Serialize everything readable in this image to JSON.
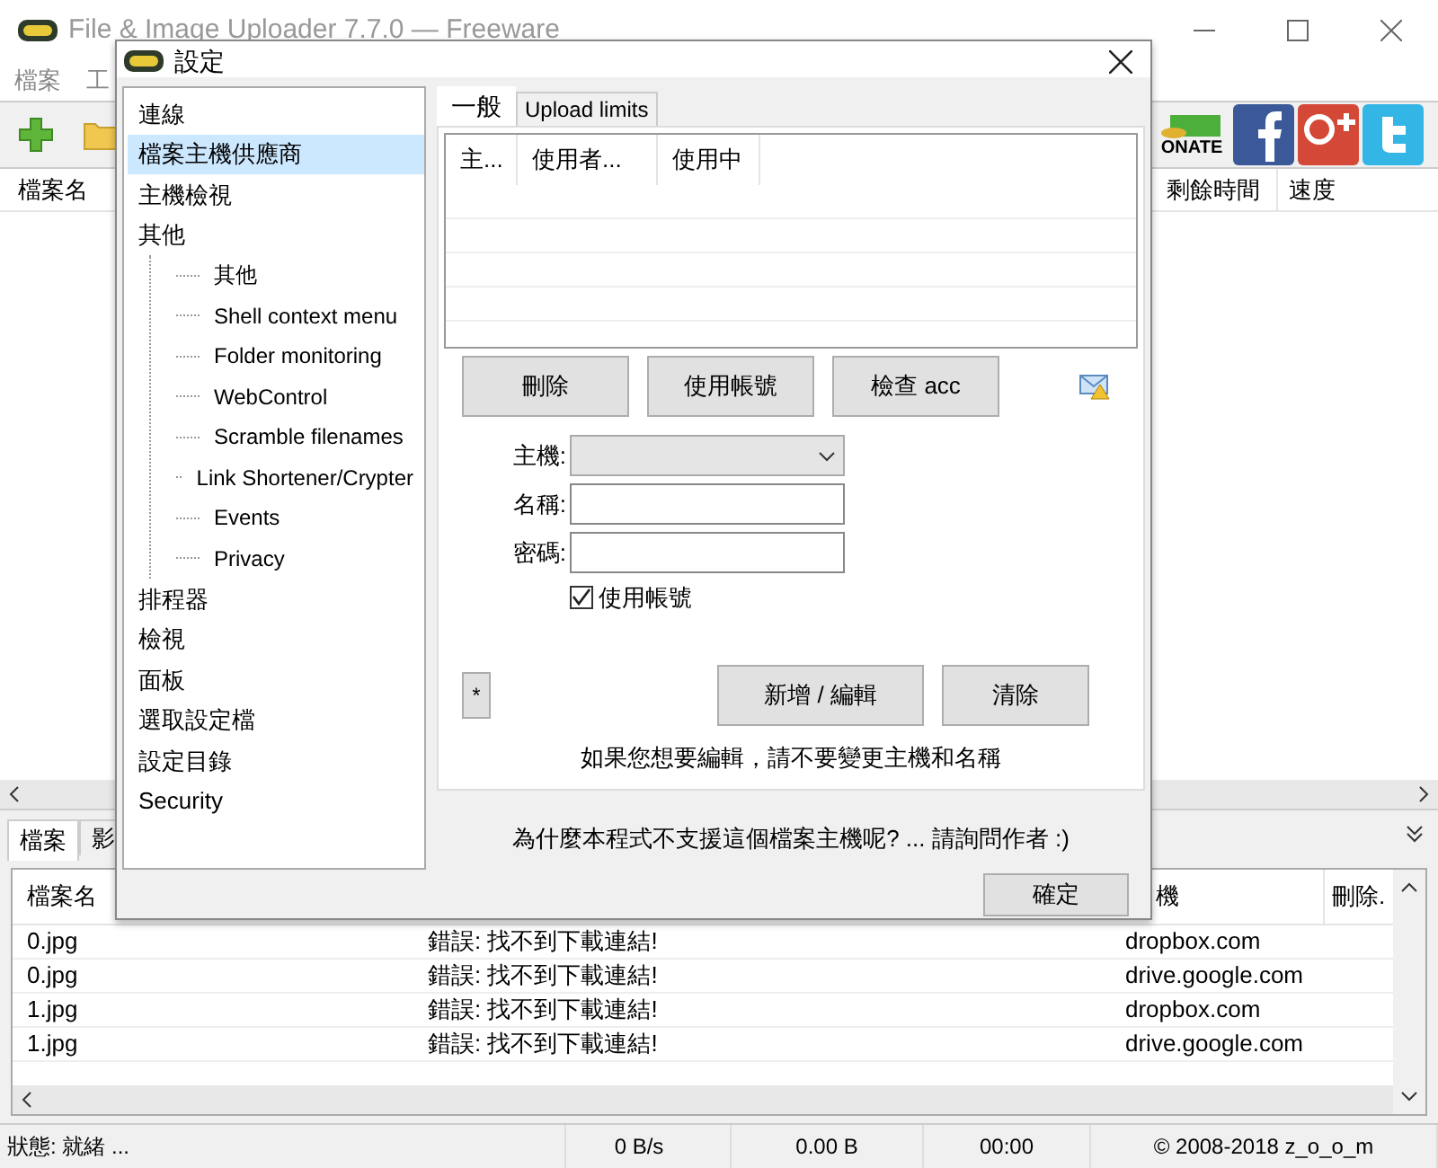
{
  "window": {
    "title": "File & Image Uploader 7.7.0 — Freeware"
  },
  "menu": [
    "檔案",
    "工"
  ],
  "toolbar": {
    "donate_label": "ONATE"
  },
  "upper_list": {
    "columns": [
      "檔案名",
      "剩餘時間",
      "速度"
    ]
  },
  "bottom_tabs": [
    {
      "label": "檔案",
      "selected": true
    },
    {
      "label": "影",
      "selected": false
    }
  ],
  "lower_list": {
    "columns": [
      "檔案名",
      "機",
      "刪除."
    ],
    "rows": [
      {
        "file": "0.jpg",
        "status": "錯誤: 找不到下載連結!",
        "host": "dropbox.com"
      },
      {
        "file": "0.jpg",
        "status": "錯誤: 找不到下載連結!",
        "host": "drive.google.com"
      },
      {
        "file": "1.jpg",
        "status": "錯誤: 找不到下載連結!",
        "host": "dropbox.com"
      },
      {
        "file": "1.jpg",
        "status": "錯誤: 找不到下載連結!",
        "host": "drive.google.com"
      }
    ]
  },
  "status_bar": [
    "狀態: 就緒 ...",
    "0 B/s",
    "0.00 B",
    "00:00",
    "© 2008-2018 z_o_o_m"
  ],
  "dialog": {
    "title": "設定",
    "tree": [
      {
        "label": "連線",
        "selected": false
      },
      {
        "label": "檔案主機供應商",
        "selected": true
      },
      {
        "label": "主機檢視",
        "selected": false
      },
      {
        "label": "其他",
        "selected": false,
        "children": [
          {
            "label": "其他",
            "selected": false
          },
          {
            "label": "Shell context menu",
            "selected": false
          },
          {
            "label": "Folder monitoring",
            "selected": false
          },
          {
            "label": "WebControl",
            "selected": false
          },
          {
            "label": "Scramble filenames",
            "selected": false
          },
          {
            "label": "Link Shortener/Crypter",
            "selected": false
          },
          {
            "label": "Events",
            "selected": false
          },
          {
            "label": "Privacy",
            "selected": false
          }
        ]
      },
      {
        "label": "排程器",
        "selected": false
      },
      {
        "label": "檢視",
        "selected": false
      },
      {
        "label": "面板",
        "selected": false
      },
      {
        "label": "選取設定檔",
        "selected": false
      },
      {
        "label": "設定目錄",
        "selected": false
      },
      {
        "label": "Security",
        "selected": false
      }
    ],
    "tabs": [
      {
        "label": "一般",
        "selected": true
      },
      {
        "label": "Upload limits",
        "selected": false
      }
    ],
    "accounts_table": {
      "columns": [
        "主...",
        "使用者...",
        "使用中"
      ]
    },
    "buttons": [
      "刪除",
      "使用帳號",
      "檢查 acc"
    ],
    "form": {
      "host_label": "主機:",
      "name_label": "名稱:",
      "password_label": "密碼:",
      "use_account": {
        "label": "使用帳號",
        "checked": true
      }
    },
    "star_button": "*",
    "action_buttons": [
      "新增 / 編輯",
      "清除"
    ],
    "hint": "如果您想要編輯，請不要變更主機和名稱",
    "footer": "為什麼本程式不支援這個檔案主機呢? ... 請詢問作者 :)",
    "ok_button": "確定"
  }
}
